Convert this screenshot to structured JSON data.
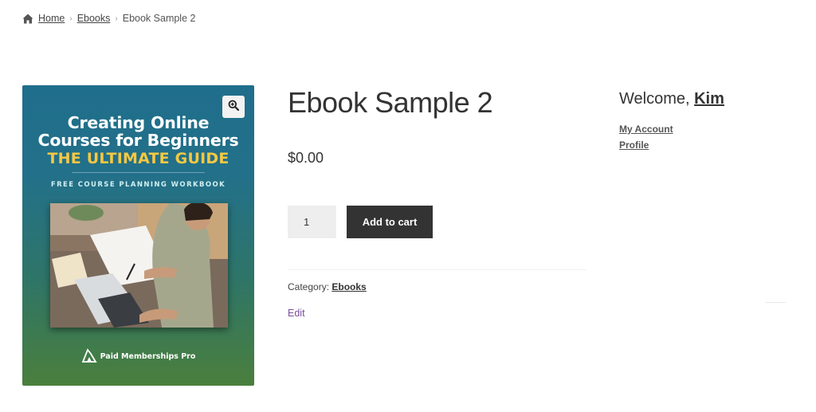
{
  "breadcrumb": {
    "icon": "home-icon",
    "items": [
      "Home",
      "Ebooks",
      "Ebook Sample 2"
    ]
  },
  "product": {
    "title": "Ebook Sample 2",
    "price": "$0.00",
    "quantity": "1",
    "add_to_cart_label": "Add to cart",
    "category_label": "Category:",
    "category_value": "Ebooks",
    "edit_label": "Edit",
    "zoom_icon": "zoom-in-icon"
  },
  "cover": {
    "title_line1": "Creating Online",
    "title_line2": "Courses for Beginners",
    "subtitle": "THE ULTIMATE GUIDE",
    "workbook": "FREE COURSE PLANNING WORKBOOK",
    "brand": "Paid Memberships Pro",
    "subtitle_color": "#f5c842"
  },
  "sidebar": {
    "welcome_prefix": "Welcome,",
    "user_name": "Kim",
    "links": [
      "My Account",
      "Profile"
    ]
  },
  "colors": {
    "button_bg": "#333333",
    "edit_link": "#7b4c9c"
  }
}
